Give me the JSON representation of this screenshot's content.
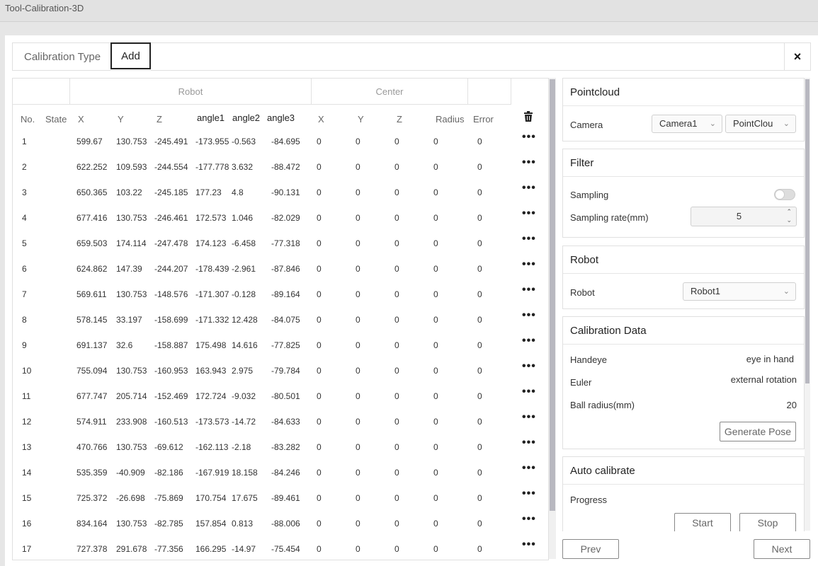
{
  "window": {
    "title": "Tool-Calibration-3D"
  },
  "tabs": {
    "calibration_type": "Calibration Type",
    "add": "Add"
  },
  "close_label": "×",
  "table": {
    "group_robot": "Robot",
    "group_center": "Center",
    "headers": {
      "no": "No.",
      "state": "State",
      "x": "X",
      "y": "Y",
      "z": "Z",
      "angle1": "angle1",
      "angle2": "angle2",
      "angle3": "angle3",
      "cx": "X",
      "cy": "Y",
      "cz": "Z",
      "radius": "Radius",
      "error": "Error"
    },
    "rows": [
      {
        "no": "1",
        "x": "599.67",
        "y": "130.753",
        "z": "-245.491",
        "a1": "-173.955",
        "a2": "-0.563",
        "a3": "-84.695",
        "cx": "0",
        "cy": "0",
        "cz": "0",
        "r": "0",
        "e": "0"
      },
      {
        "no": "2",
        "x": "622.252",
        "y": "109.593",
        "z": "-244.554",
        "a1": "-177.778",
        "a2": "3.632",
        "a3": "-88.472",
        "cx": "0",
        "cy": "0",
        "cz": "0",
        "r": "0",
        "e": "0"
      },
      {
        "no": "3",
        "x": "650.365",
        "y": "103.22",
        "z": "-245.185",
        "a1": "177.23",
        "a2": "4.8",
        "a3": "-90.131",
        "cx": "0",
        "cy": "0",
        "cz": "0",
        "r": "0",
        "e": "0"
      },
      {
        "no": "4",
        "x": "677.416",
        "y": "130.753",
        "z": "-246.461",
        "a1": "172.573",
        "a2": "1.046",
        "a3": "-82.029",
        "cx": "0",
        "cy": "0",
        "cz": "0",
        "r": "0",
        "e": "0"
      },
      {
        "no": "5",
        "x": "659.503",
        "y": "174.114",
        "z": "-247.478",
        "a1": "174.123",
        "a2": "-6.458",
        "a3": "-77.318",
        "cx": "0",
        "cy": "0",
        "cz": "0",
        "r": "0",
        "e": "0"
      },
      {
        "no": "6",
        "x": "624.862",
        "y": "147.39",
        "z": "-244.207",
        "a1": "-178.439",
        "a2": "-2.961",
        "a3": "-87.846",
        "cx": "0",
        "cy": "0",
        "cz": "0",
        "r": "0",
        "e": "0"
      },
      {
        "no": "7",
        "x": "569.611",
        "y": "130.753",
        "z": "-148.576",
        "a1": "-171.307",
        "a2": "-0.128",
        "a3": "-89.164",
        "cx": "0",
        "cy": "0",
        "cz": "0",
        "r": "0",
        "e": "0"
      },
      {
        "no": "8",
        "x": "578.145",
        "y": "33.197",
        "z": "-158.699",
        "a1": "-171.332",
        "a2": "12.428",
        "a3": "-84.075",
        "cx": "0",
        "cy": "0",
        "cz": "0",
        "r": "0",
        "e": "0"
      },
      {
        "no": "9",
        "x": "691.137",
        "y": "32.6",
        "z": "-158.887",
        "a1": "175.498",
        "a2": "14.616",
        "a3": "-77.825",
        "cx": "0",
        "cy": "0",
        "cz": "0",
        "r": "0",
        "e": "0"
      },
      {
        "no": "10",
        "x": "755.094",
        "y": "130.753",
        "z": "-160.953",
        "a1": "163.943",
        "a2": "2.975",
        "a3": "-79.784",
        "cx": "0",
        "cy": "0",
        "cz": "0",
        "r": "0",
        "e": "0"
      },
      {
        "no": "11",
        "x": "677.747",
        "y": "205.714",
        "z": "-152.469",
        "a1": "172.724",
        "a2": "-9.032",
        "a3": "-80.501",
        "cx": "0",
        "cy": "0",
        "cz": "0",
        "r": "0",
        "e": "0"
      },
      {
        "no": "12",
        "x": "574.911",
        "y": "233.908",
        "z": "-160.513",
        "a1": "-173.573",
        "a2": "-14.72",
        "a3": "-84.633",
        "cx": "0",
        "cy": "0",
        "cz": "0",
        "r": "0",
        "e": "0"
      },
      {
        "no": "13",
        "x": "470.766",
        "y": "130.753",
        "z": "-69.612",
        "a1": "-162.113",
        "a2": "-2.18",
        "a3": "-83.282",
        "cx": "0",
        "cy": "0",
        "cz": "0",
        "r": "0",
        "e": "0"
      },
      {
        "no": "14",
        "x": "535.359",
        "y": "-40.909",
        "z": "-82.186",
        "a1": "-167.919",
        "a2": "18.158",
        "a3": "-84.246",
        "cx": "0",
        "cy": "0",
        "cz": "0",
        "r": "0",
        "e": "0"
      },
      {
        "no": "15",
        "x": "725.372",
        "y": "-26.698",
        "z": "-75.869",
        "a1": "170.754",
        "a2": "17.675",
        "a3": "-89.461",
        "cx": "0",
        "cy": "0",
        "cz": "0",
        "r": "0",
        "e": "0"
      },
      {
        "no": "16",
        "x": "834.164",
        "y": "130.753",
        "z": "-82.785",
        "a1": "157.854",
        "a2": "0.813",
        "a3": "-88.006",
        "cx": "0",
        "cy": "0",
        "cz": "0",
        "r": "0",
        "e": "0"
      },
      {
        "no": "17",
        "x": "727.378",
        "y": "291.678",
        "z": "-77.356",
        "a1": "166.295",
        "a2": "-14.97",
        "a3": "-75.454",
        "cx": "0",
        "cy": "0",
        "cz": "0",
        "r": "0",
        "e": "0"
      }
    ]
  },
  "pointcloud": {
    "title": "Pointcloud",
    "camera_label": "Camera",
    "camera_value": "Camera1",
    "source_value": "PointClou"
  },
  "filter": {
    "title": "Filter",
    "sampling_label": "Sampling",
    "sampling_on": false,
    "rate_label": "Sampling rate(mm)",
    "rate_value": "5"
  },
  "robot": {
    "title": "Robot",
    "robot_label": "Robot",
    "robot_value": "Robot1"
  },
  "calibration_data": {
    "title": "Calibration Data",
    "handeye_label": "Handeye",
    "handeye_value": "eye in hand",
    "euler_label": "Euler",
    "euler_value": "external rotation",
    "ball_label": "Ball radius(mm)",
    "ball_value": "20",
    "generate_label": "Generate Pose"
  },
  "auto_calibrate": {
    "title": "Auto calibrate",
    "progress_label": "Progress",
    "start_label": "Start",
    "stop_label": "Stop"
  },
  "footer": {
    "prev_label": "Prev",
    "next_label": "Next"
  },
  "colors": {
    "accent": "#222222",
    "border": "#e0e0e0",
    "scroll_thumb": "#b8b8c0"
  }
}
